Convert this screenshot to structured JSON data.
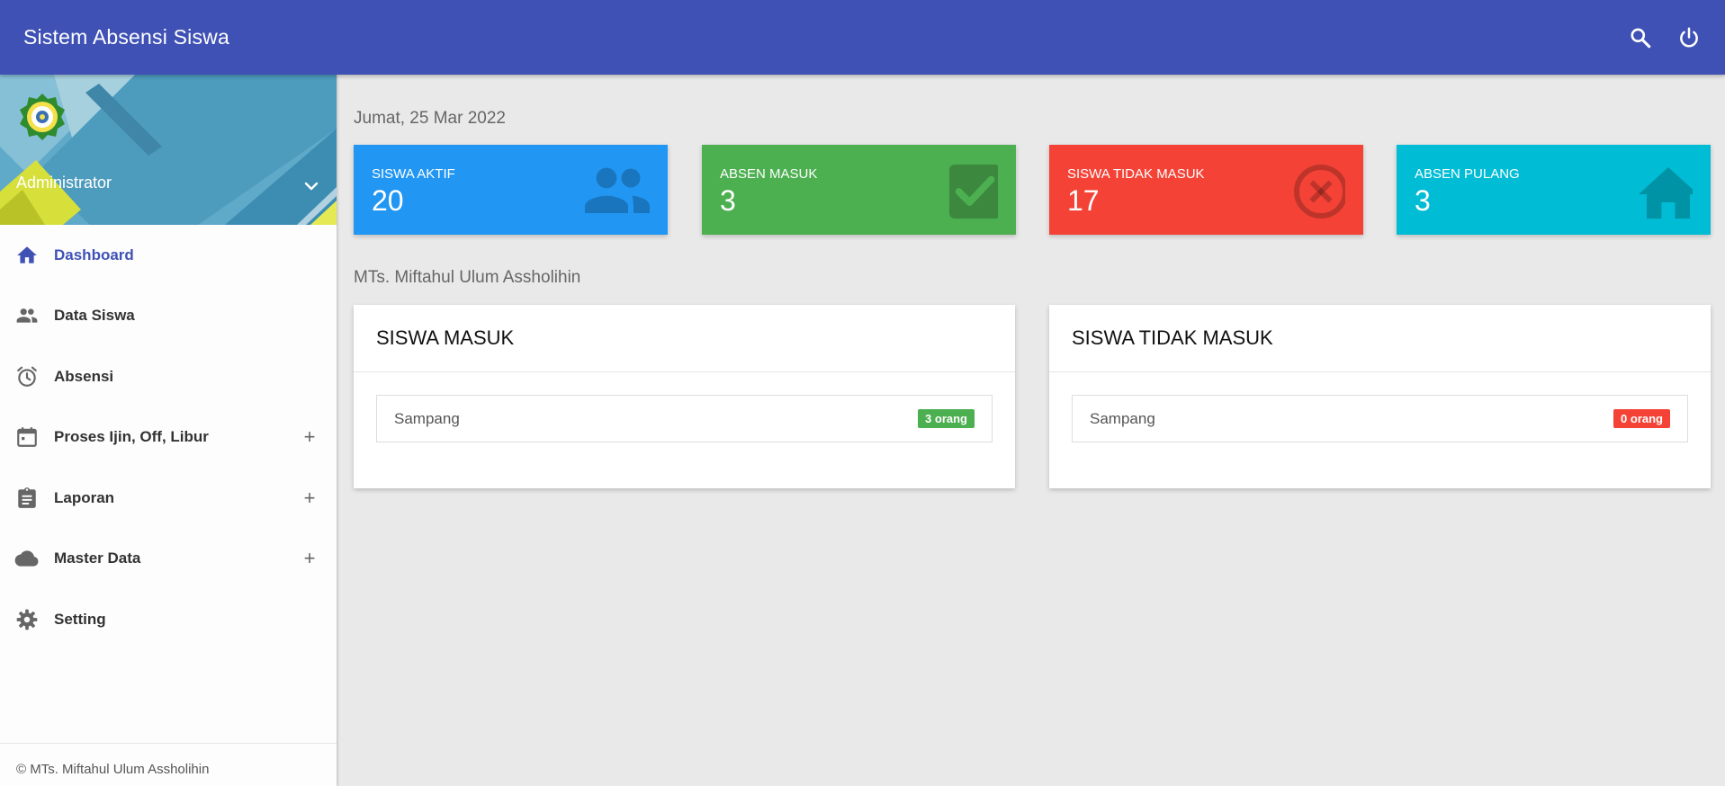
{
  "header": {
    "title": "Sistem Absensi Siswa",
    "icons": [
      "search-icon",
      "power-icon"
    ],
    "color": "#3f51b5"
  },
  "sidebar": {
    "user_name": "Administrator",
    "menu": [
      {
        "label": "Dashboard",
        "icon": "home-icon",
        "active": true
      },
      {
        "label": "Data Siswa",
        "icon": "people-icon"
      },
      {
        "label": "Absensi",
        "icon": "alarm-icon"
      },
      {
        "label": "Proses Ijin, Off, Libur",
        "icon": "calendar-icon",
        "expand": "+"
      },
      {
        "label": "Laporan",
        "icon": "clipboard-icon",
        "expand": "+"
      },
      {
        "label": "Master Data",
        "icon": "cloud-icon",
        "expand": "+"
      },
      {
        "label": "Setting",
        "icon": "gear-icon"
      }
    ],
    "footer": "© MTs. Miftahul Ulum Assholihin"
  },
  "main": {
    "date": "Jumat, 25 Mar 2022",
    "cards": [
      {
        "label": "SISWA AKTIF",
        "value": "20",
        "icon": "people-icon",
        "color": "#2196f3"
      },
      {
        "label": "ABSEN MASUK",
        "value": "3",
        "icon": "check-box-icon",
        "color": "#4caf50"
      },
      {
        "label": "SISWA TIDAK MASUK",
        "value": "17",
        "icon": "cancel-icon",
        "color": "#f44336"
      },
      {
        "label": "ABSEN PULANG",
        "value": "3",
        "icon": "home-icon",
        "color": "#00bcd4"
      }
    ],
    "school": "MTs. Miftahul Ulum Assholihin",
    "panels": [
      {
        "title": "SISWA MASUK",
        "rows": [
          {
            "name": "Sampang",
            "badge": "3 orang",
            "badge_color": "#4caf50"
          }
        ]
      },
      {
        "title": "SISWA TIDAK MASUK",
        "rows": [
          {
            "name": "Sampang",
            "badge": "0 orang",
            "badge_color": "#f44336"
          }
        ]
      }
    ]
  }
}
